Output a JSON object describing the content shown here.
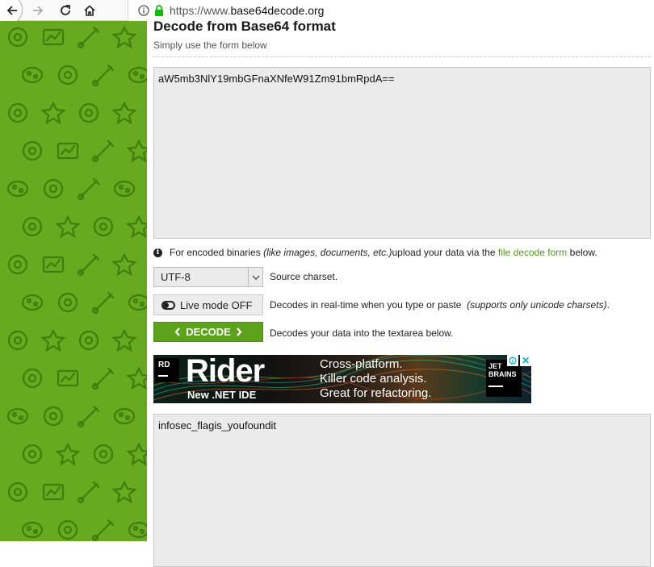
{
  "browser": {
    "url_prefix": "https://www.",
    "url_domain": "base64decode.org",
    "url_suffix": ""
  },
  "page": {
    "title": "Decode from Base64 format",
    "subtitle": "Simply use the form below"
  },
  "input": {
    "value": "aW5mb3NlY19mbGFnaXNfeW91Zm91bmRpdA=="
  },
  "note": {
    "prefix": "For encoded binaries ",
    "italic": "(like images, documents, etc.)",
    "middle": " upload your data via the ",
    "link": "file decode form",
    "suffix": " below."
  },
  "charset": {
    "selected": "UTF-8",
    "label": "Source charset."
  },
  "live_mode": {
    "button_label": "Live mode OFF",
    "description": "Decodes in real-time when you type or paste ",
    "description_italic": "(supports only unicode charsets)",
    "description_end": "."
  },
  "decode": {
    "button_label": "DECODE",
    "description": "Decodes your data into the textarea below."
  },
  "ad": {
    "rd_logo": "RD",
    "product": "Rider",
    "product_sub": "New .NET IDE",
    "tagline_1": "Cross-platform.",
    "tagline_2": "Killer code analysis.",
    "tagline_3": "Great for refactoring.",
    "jb_logo_1": "JET",
    "jb_logo_2": "BRAINS",
    "close": "✕"
  },
  "output": {
    "value": "infosec_flagis_youfoundit"
  },
  "colors": {
    "sidebar_green": "#67a91f",
    "decode_button": "#5ca31b",
    "link_green": "#4f9b1a"
  },
  "icons": [
    "back-arrow-icon",
    "forward-arrow-icon",
    "reload-icon",
    "home-icon",
    "site-info-icon",
    "lock-icon",
    "info-icon",
    "toggle-icon",
    "chevron-left-icon",
    "chevron-right-icon",
    "dropdown-arrow-icon"
  ]
}
